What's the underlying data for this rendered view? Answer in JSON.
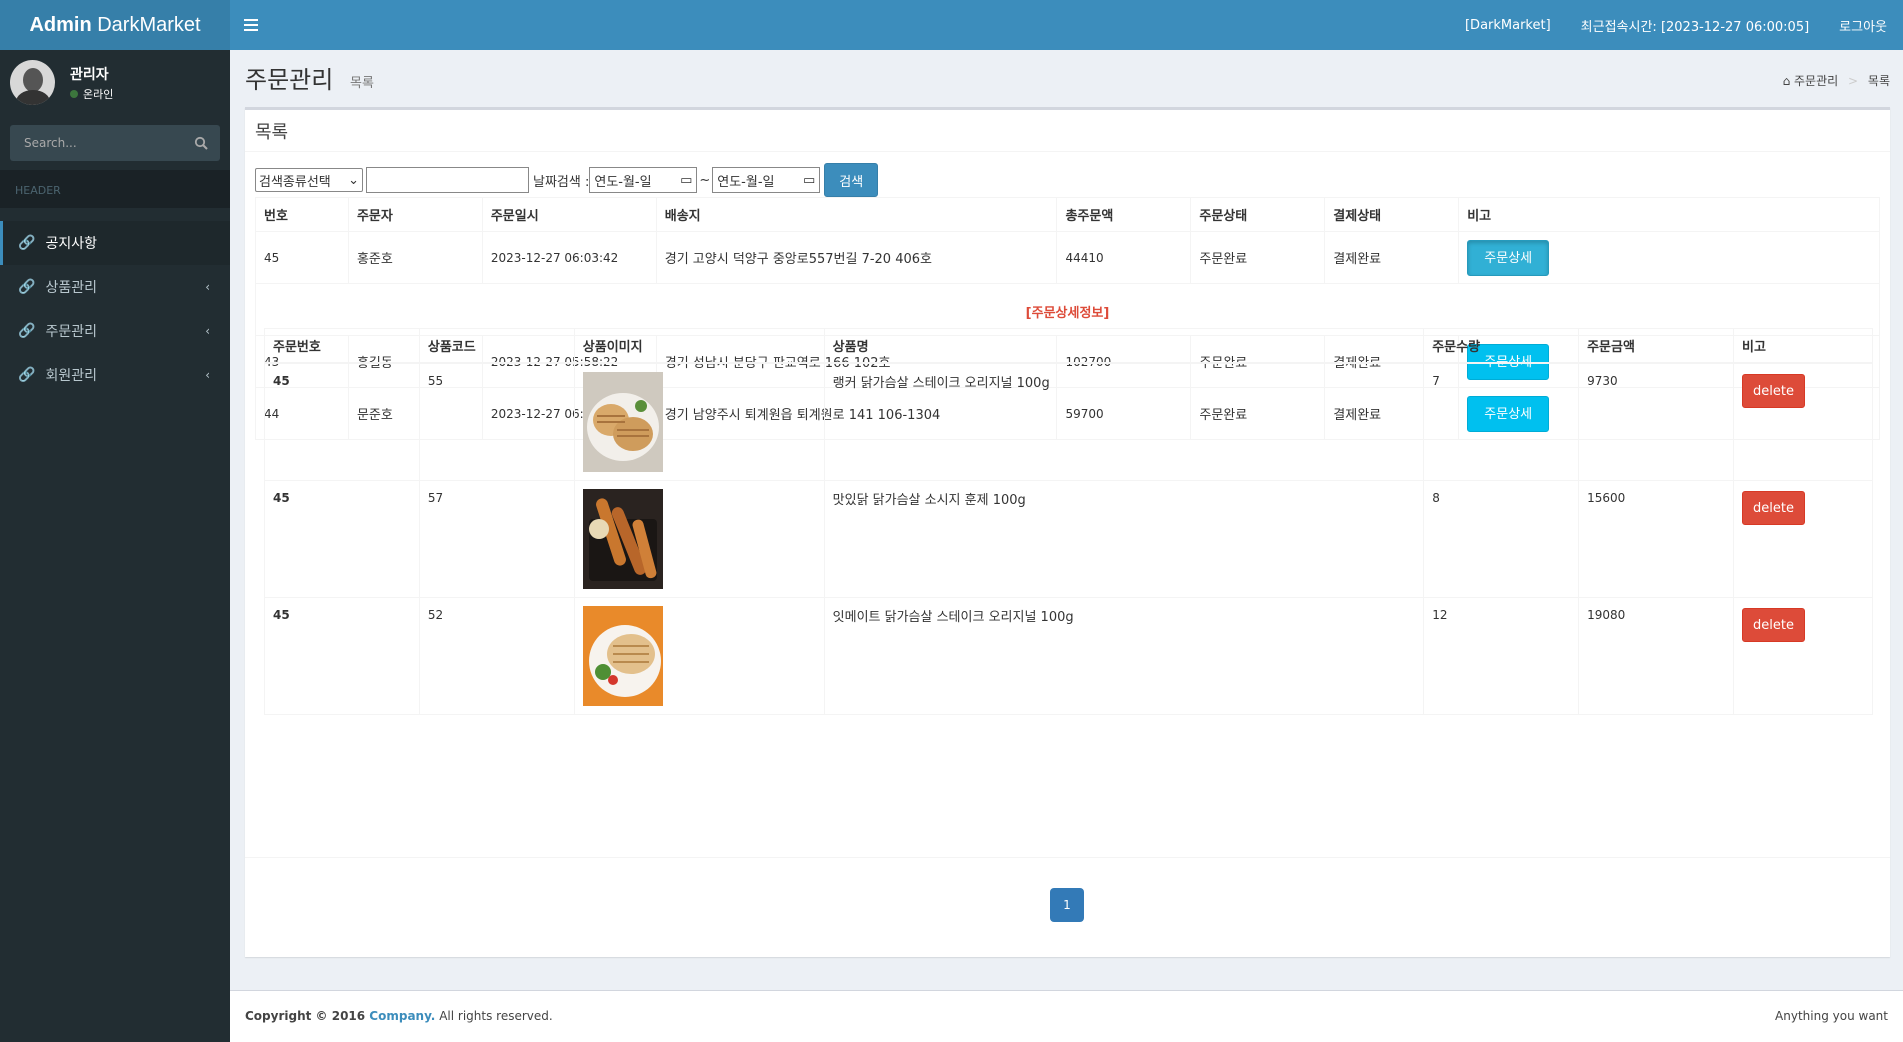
{
  "header": {
    "logo_bold": "Admin",
    "logo_rest": " DarkMarket",
    "site_tag": "[DarkMarket]",
    "last_login": "최근접속시간: [2023-12-27 06:00:05]",
    "logout": "로그아웃"
  },
  "sidebar": {
    "user_name": "관리자",
    "user_status": "온라인",
    "search_placeholder": "Search...",
    "section_header": "HEADER",
    "items": [
      {
        "label": "공지사항"
      },
      {
        "label": "상품관리"
      },
      {
        "label": "주문관리"
      },
      {
        "label": "회원관리"
      }
    ]
  },
  "page": {
    "title": "주문관리",
    "subtitle": "목록",
    "breadcrumb": [
      "주문관리",
      "목록"
    ]
  },
  "box": {
    "title": "목록",
    "filters": {
      "search_type": "검색종류선택",
      "keyword": "",
      "date_label": "날짜검색 :",
      "date_from": "연도-월-일",
      "tilde": "~",
      "date_to": "연도-월-일",
      "search_button": "검색"
    },
    "columns": [
      "번호",
      "주문자",
      "주문일시",
      "배송지",
      "총주문액",
      "주문상태",
      "결제상태",
      "비고"
    ],
    "orders": [
      {
        "no": "45",
        "name": "홍준호",
        "date": "2023-12-27 06:03:42",
        "address": "경기 고양시 덕양구 중앙로557번길 7-20 406호",
        "total": "44410",
        "order_status": "주문완료",
        "pay_status": "결제완료",
        "action": "주문상세"
      },
      {
        "no": "43",
        "name": "홍길동",
        "date": "2023-12-27 05:58:22",
        "address": "경기 성남시 분당구 판교역로 166 102호",
        "total": "102700",
        "order_status": "주문완료",
        "pay_status": "결제완료",
        "action": "주문상세"
      },
      {
        "no": "44",
        "name": "문준호",
        "date": "2023-12-27 06:02:39",
        "address": "경기 남양주시 퇴계원읍 퇴계원로 141 106-1304",
        "total": "59700",
        "order_status": "주문완료",
        "pay_status": "결제완료",
        "action": "주문상세"
      }
    ],
    "detail": {
      "title": "[주문상세정보]",
      "columns": [
        "주문번호",
        "상품코드",
        "상품이미지",
        "상품명",
        "주문수량",
        "주문금액",
        "비고"
      ],
      "items": [
        {
          "order_no": "45",
          "code": "55",
          "name": "랭커 닭가슴살 스테이크 오리지널 100g",
          "qty": "7",
          "amount": "9730",
          "action": "delete"
        },
        {
          "order_no": "45",
          "code": "57",
          "name": "맛있닭 닭가슴살 소시지 훈제 100g",
          "qty": "8",
          "amount": "15600",
          "action": "delete"
        },
        {
          "order_no": "45",
          "code": "52",
          "name": "잇메이트 닭가슴살 스테이크 오리지널 100g",
          "qty": "12",
          "amount": "19080",
          "action": "delete"
        }
      ]
    },
    "page_number": "1"
  },
  "footer": {
    "copyright": "Copyright © 2016 ",
    "company": "Company.",
    "rights": " All rights reserved.",
    "right_text": "Anything you want"
  },
  "colors": {
    "header": "#3c8dbc",
    "logo": "#367fa9",
    "sidebar": "#222d32",
    "info_button": "#00c0ef",
    "danger_button": "#dd4b39"
  }
}
